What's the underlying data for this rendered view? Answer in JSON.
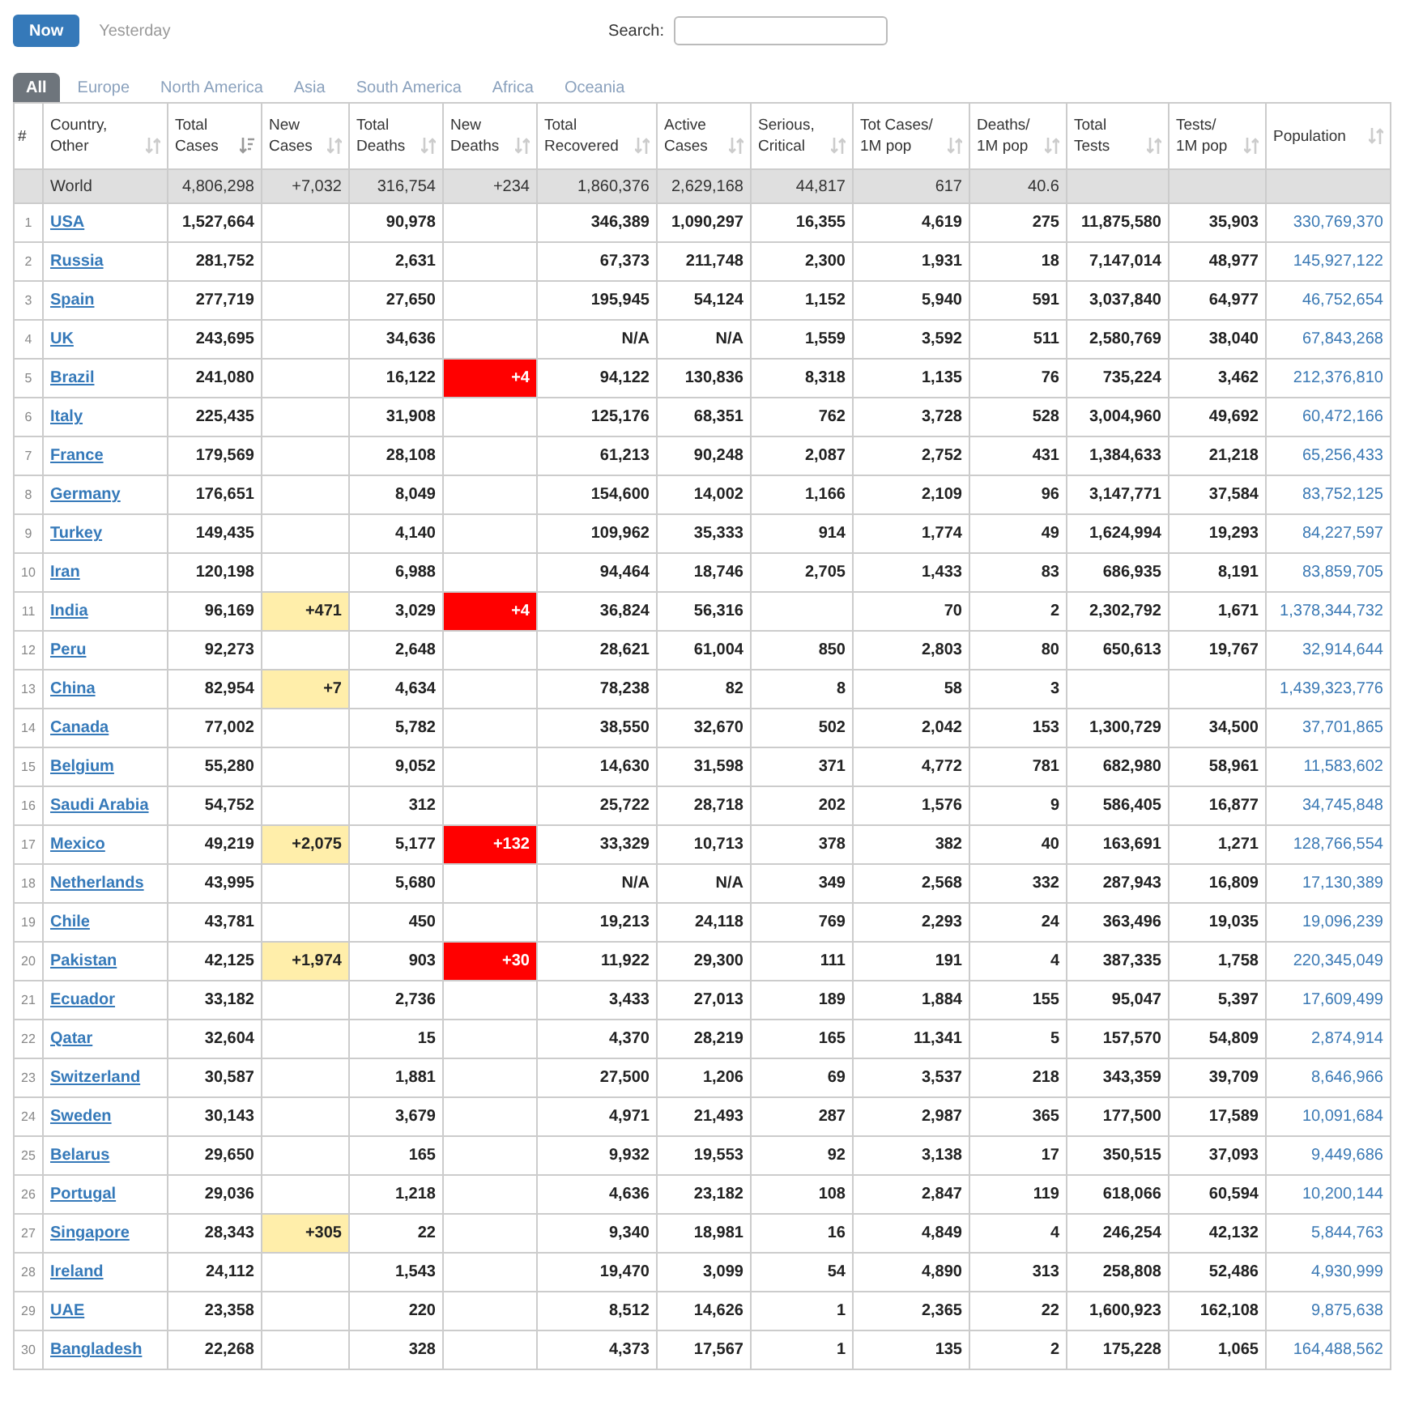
{
  "day_buttons": [
    {
      "label": "Now",
      "selected": true
    },
    {
      "label": "Yesterday",
      "selected": false
    }
  ],
  "search": {
    "label": "Search:"
  },
  "region_tabs": [
    {
      "label": "All",
      "selected": true
    },
    {
      "label": "Europe",
      "selected": false
    },
    {
      "label": "North America",
      "selected": false
    },
    {
      "label": "Asia",
      "selected": false
    },
    {
      "label": "South America",
      "selected": false
    },
    {
      "label": "Africa",
      "selected": false
    },
    {
      "label": "Oceania",
      "selected": false
    }
  ],
  "table": {
    "columns": [
      {
        "kind": "rank",
        "label": [
          "#"
        ]
      },
      {
        "kind": "country",
        "label": [
          "Country,",
          "Other"
        ],
        "sorted": false
      },
      {
        "kind": "number",
        "label": [
          "Total",
          "Cases"
        ],
        "sorted": true
      },
      {
        "kind": "new_cases",
        "label": [
          "New",
          "Cases"
        ],
        "sorted": false
      },
      {
        "kind": "number",
        "label": [
          "Total",
          "Deaths"
        ],
        "sorted": false
      },
      {
        "kind": "new_deaths",
        "label": [
          "New",
          "Deaths"
        ],
        "sorted": false
      },
      {
        "kind": "number",
        "label": [
          "Total",
          "Recovered"
        ],
        "sorted": false
      },
      {
        "kind": "number",
        "label": [
          "Active",
          "Cases"
        ],
        "sorted": false
      },
      {
        "kind": "number",
        "label": [
          "Serious,",
          "Critical"
        ],
        "sorted": false
      },
      {
        "kind": "number",
        "label": [
          "Tot Cases/",
          "1M pop"
        ],
        "sorted": false
      },
      {
        "kind": "number",
        "label": [
          "Deaths/",
          "1M pop"
        ],
        "sorted": false
      },
      {
        "kind": "number",
        "label": [
          "Total",
          "Tests"
        ],
        "sorted": false
      },
      {
        "kind": "number",
        "label": [
          "Tests/",
          "1M pop"
        ],
        "sorted": false
      },
      {
        "kind": "population",
        "label": [
          "Population"
        ],
        "sorted": false
      }
    ],
    "rows": [
      {
        "kind": "total",
        "cells": [
          null,
          "World",
          "4,806,298",
          "+7,032",
          "316,754",
          "+234",
          "1,860,376",
          "2,629,168",
          "44,817",
          "617",
          "40.6",
          null,
          null,
          null
        ]
      },
      {
        "kind": "country",
        "cells": [
          "1",
          "USA",
          "1,527,664",
          null,
          "90,978",
          null,
          "346,389",
          "1,090,297",
          "16,355",
          "4,619",
          "275",
          "11,875,580",
          "35,903",
          "330,769,370"
        ]
      },
      {
        "kind": "country",
        "cells": [
          "2",
          "Russia",
          "281,752",
          null,
          "2,631",
          null,
          "67,373",
          "211,748",
          "2,300",
          "1,931",
          "18",
          "7,147,014",
          "48,977",
          "145,927,122"
        ]
      },
      {
        "kind": "country",
        "cells": [
          "3",
          "Spain",
          "277,719",
          null,
          "27,650",
          null,
          "195,945",
          "54,124",
          "1,152",
          "5,940",
          "591",
          "3,037,840",
          "64,977",
          "46,752,654"
        ]
      },
      {
        "kind": "country",
        "cells": [
          "4",
          "UK",
          "243,695",
          null,
          "34,636",
          null,
          "N/A",
          "N/A",
          "1,559",
          "3,592",
          "511",
          "2,580,769",
          "38,040",
          "67,843,268"
        ]
      },
      {
        "kind": "country",
        "cells": [
          "5",
          "Brazil",
          "241,080",
          null,
          "16,122",
          "+4",
          "94,122",
          "130,836",
          "8,318",
          "1,135",
          "76",
          "735,224",
          "3,462",
          "212,376,810"
        ]
      },
      {
        "kind": "country",
        "cells": [
          "6",
          "Italy",
          "225,435",
          null,
          "31,908",
          null,
          "125,176",
          "68,351",
          "762",
          "3,728",
          "528",
          "3,004,960",
          "49,692",
          "60,472,166"
        ]
      },
      {
        "kind": "country",
        "cells": [
          "7",
          "France",
          "179,569",
          null,
          "28,108",
          null,
          "61,213",
          "90,248",
          "2,087",
          "2,752",
          "431",
          "1,384,633",
          "21,218",
          "65,256,433"
        ]
      },
      {
        "kind": "country",
        "cells": [
          "8",
          "Germany",
          "176,651",
          null,
          "8,049",
          null,
          "154,600",
          "14,002",
          "1,166",
          "2,109",
          "96",
          "3,147,771",
          "37,584",
          "83,752,125"
        ]
      },
      {
        "kind": "country",
        "cells": [
          "9",
          "Turkey",
          "149,435",
          null,
          "4,140",
          null,
          "109,962",
          "35,333",
          "914",
          "1,774",
          "49",
          "1,624,994",
          "19,293",
          "84,227,597"
        ]
      },
      {
        "kind": "country",
        "cells": [
          "10",
          "Iran",
          "120,198",
          null,
          "6,988",
          null,
          "94,464",
          "18,746",
          "2,705",
          "1,433",
          "83",
          "686,935",
          "8,191",
          "83,859,705"
        ]
      },
      {
        "kind": "country",
        "cells": [
          "11",
          "India",
          "96,169",
          "+471",
          "3,029",
          "+4",
          "36,824",
          "56,316",
          null,
          "70",
          "2",
          "2,302,792",
          "1,671",
          "1,378,344,732"
        ]
      },
      {
        "kind": "country",
        "cells": [
          "12",
          "Peru",
          "92,273",
          null,
          "2,648",
          null,
          "28,621",
          "61,004",
          "850",
          "2,803",
          "80",
          "650,613",
          "19,767",
          "32,914,644"
        ]
      },
      {
        "kind": "country",
        "cells": [
          "13",
          "China",
          "82,954",
          "+7",
          "4,634",
          null,
          "78,238",
          "82",
          "8",
          "58",
          "3",
          null,
          null,
          "1,439,323,776"
        ]
      },
      {
        "kind": "country",
        "cells": [
          "14",
          "Canada",
          "77,002",
          null,
          "5,782",
          null,
          "38,550",
          "32,670",
          "502",
          "2,042",
          "153",
          "1,300,729",
          "34,500",
          "37,701,865"
        ]
      },
      {
        "kind": "country",
        "cells": [
          "15",
          "Belgium",
          "55,280",
          null,
          "9,052",
          null,
          "14,630",
          "31,598",
          "371",
          "4,772",
          "781",
          "682,980",
          "58,961",
          "11,583,602"
        ]
      },
      {
        "kind": "country",
        "cells": [
          "16",
          "Saudi Arabia",
          "54,752",
          null,
          "312",
          null,
          "25,722",
          "28,718",
          "202",
          "1,576",
          "9",
          "586,405",
          "16,877",
          "34,745,848"
        ]
      },
      {
        "kind": "country",
        "cells": [
          "17",
          "Mexico",
          "49,219",
          "+2,075",
          "5,177",
          "+132",
          "33,329",
          "10,713",
          "378",
          "382",
          "40",
          "163,691",
          "1,271",
          "128,766,554"
        ]
      },
      {
        "kind": "country",
        "cells": [
          "18",
          "Netherlands",
          "43,995",
          null,
          "5,680",
          null,
          "N/A",
          "N/A",
          "349",
          "2,568",
          "332",
          "287,943",
          "16,809",
          "17,130,389"
        ]
      },
      {
        "kind": "country",
        "cells": [
          "19",
          "Chile",
          "43,781",
          null,
          "450",
          null,
          "19,213",
          "24,118",
          "769",
          "2,293",
          "24",
          "363,496",
          "19,035",
          "19,096,239"
        ]
      },
      {
        "kind": "country",
        "cells": [
          "20",
          "Pakistan",
          "42,125",
          "+1,974",
          "903",
          "+30",
          "11,922",
          "29,300",
          "111",
          "191",
          "4",
          "387,335",
          "1,758",
          "220,345,049"
        ]
      },
      {
        "kind": "country",
        "cells": [
          "21",
          "Ecuador",
          "33,182",
          null,
          "2,736",
          null,
          "3,433",
          "27,013",
          "189",
          "1,884",
          "155",
          "95,047",
          "5,397",
          "17,609,499"
        ]
      },
      {
        "kind": "country",
        "cells": [
          "22",
          "Qatar",
          "32,604",
          null,
          "15",
          null,
          "4,370",
          "28,219",
          "165",
          "11,341",
          "5",
          "157,570",
          "54,809",
          "2,874,914"
        ]
      },
      {
        "kind": "country",
        "cells": [
          "23",
          "Switzerland",
          "30,587",
          null,
          "1,881",
          null,
          "27,500",
          "1,206",
          "69",
          "3,537",
          "218",
          "343,359",
          "39,709",
          "8,646,966"
        ]
      },
      {
        "kind": "country",
        "cells": [
          "24",
          "Sweden",
          "30,143",
          null,
          "3,679",
          null,
          "4,971",
          "21,493",
          "287",
          "2,987",
          "365",
          "177,500",
          "17,589",
          "10,091,684"
        ]
      },
      {
        "kind": "country",
        "cells": [
          "25",
          "Belarus",
          "29,650",
          null,
          "165",
          null,
          "9,932",
          "19,553",
          "92",
          "3,138",
          "17",
          "350,515",
          "37,093",
          "9,449,686"
        ]
      },
      {
        "kind": "country",
        "cells": [
          "26",
          "Portugal",
          "29,036",
          null,
          "1,218",
          null,
          "4,636",
          "23,182",
          "108",
          "2,847",
          "119",
          "618,066",
          "60,594",
          "10,200,144"
        ]
      },
      {
        "kind": "country",
        "cells": [
          "27",
          "Singapore",
          "28,343",
          "+305",
          "22",
          null,
          "9,340",
          "18,981",
          "16",
          "4,849",
          "4",
          "246,254",
          "42,132",
          "5,844,763"
        ]
      },
      {
        "kind": "country",
        "cells": [
          "28",
          "Ireland",
          "24,112",
          null,
          "1,543",
          null,
          "19,470",
          "3,099",
          "54",
          "4,890",
          "313",
          "258,808",
          "52,486",
          "4,930,999"
        ]
      },
      {
        "kind": "country",
        "cells": [
          "29",
          "UAE",
          "23,358",
          null,
          "220",
          null,
          "8,512",
          "14,626",
          "1",
          "2,365",
          "22",
          "1,600,923",
          "162,108",
          "9,875,638"
        ]
      },
      {
        "kind": "country",
        "cells": [
          "30",
          "Bangladesh",
          "22,268",
          null,
          "328",
          null,
          "4,373",
          "17,567",
          "1",
          "135",
          "2",
          "175,228",
          "1,065",
          "164,488,562"
        ]
      }
    ]
  }
}
